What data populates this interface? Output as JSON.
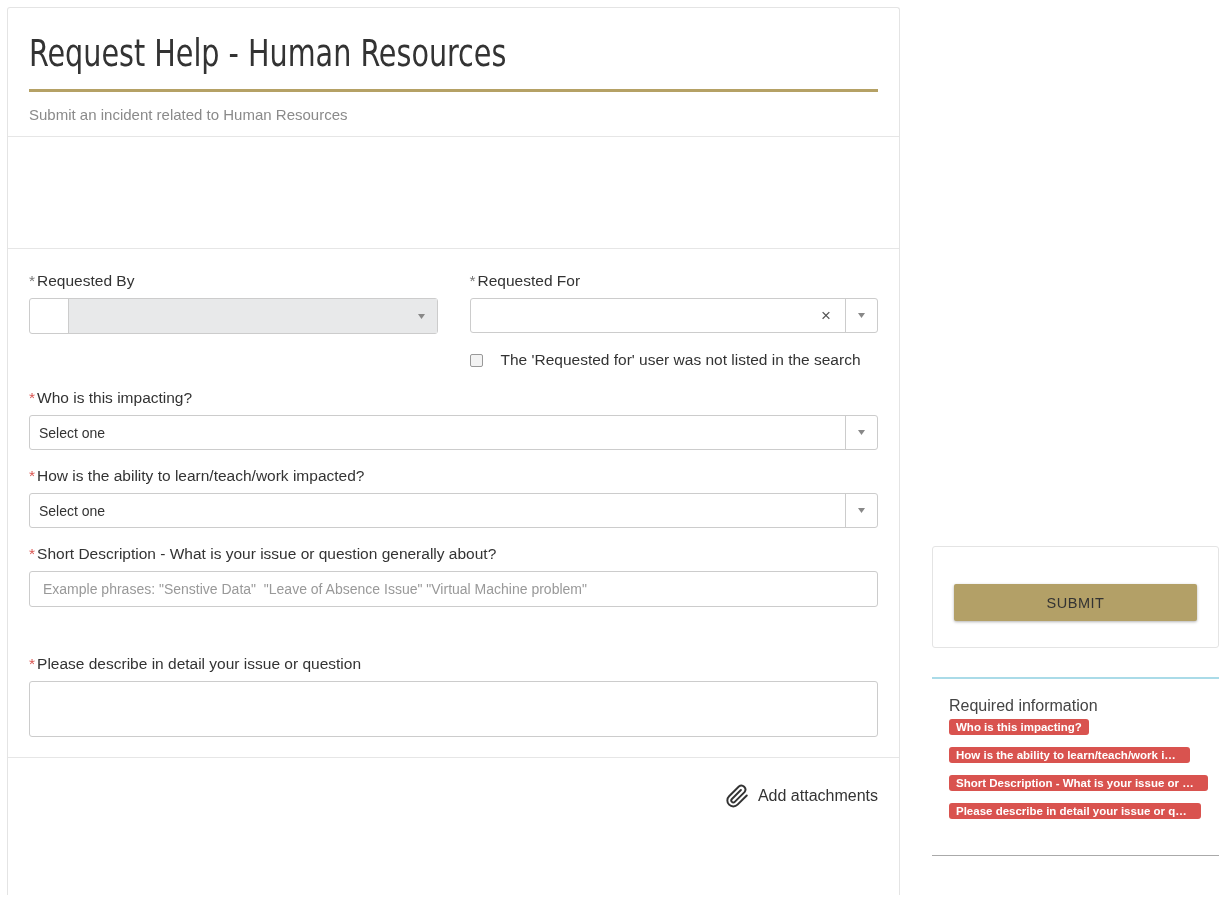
{
  "title": "Request Help - Human Resources",
  "subtitle": "Submit an incident related to Human Resources",
  "top_fields": [
    {
      "mark": "*",
      "missing": false,
      "label": "Requested By",
      "kind": "lookup",
      "disabled": true
    },
    {
      "mark": "*",
      "missing": false,
      "label": "Requested For",
      "kind": "reference",
      "clear": "×",
      "checkbox": {
        "label": "The 'Requested for' user was not listed in the search",
        "checked": false
      }
    }
  ],
  "fields": [
    {
      "mark": "*",
      "missing": true,
      "label": "Who is this impacting?",
      "kind": "select",
      "value": "Select one"
    },
    {
      "mark": "*",
      "missing": true,
      "label": "How is the ability to learn/teach/work impacted?",
      "kind": "select",
      "value": "Select one"
    },
    {
      "mark": "*",
      "missing": true,
      "label": "Short Description - What is your issue or question generally about?",
      "kind": "text",
      "placeholder": "Example phrases: \"Senstive Data\"  \"Leave of Absence Issue\" \"Virtual Machine problem\""
    },
    {
      "mark": "*",
      "missing": true,
      "label": "Please describe in detail your issue or question",
      "kind": "textarea"
    }
  ],
  "attachments": "Add attachments",
  "submit": "SUBMIT",
  "required": {
    "title": "Required information",
    "items": [
      "Who is this impacting?",
      "How is the ability to learn/teach/work i…",
      "Short Description - What is your issue or …",
      "Please describe in detail your issue or q…"
    ]
  }
}
